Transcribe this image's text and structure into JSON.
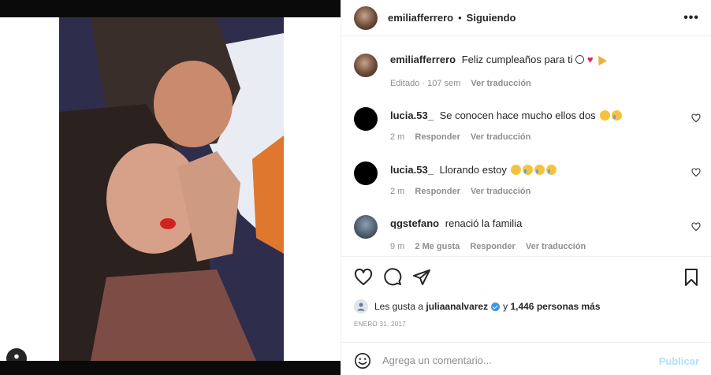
{
  "post": {
    "username": "emiliafferrero",
    "follow_status": "Siguiendo",
    "more_label": "•••"
  },
  "caption": {
    "username": "emiliafferrero",
    "text": "Feliz cumpleaños para ti",
    "emojis": [
      "soccer-ball",
      "red-heart",
      "party-popper"
    ],
    "edited": "Editado · 107 sem",
    "translate": "Ver traducción"
  },
  "comments": [
    {
      "username": "lucia.53_",
      "text": "Se conocen hace mucho ellos dos",
      "emojis": [
        "sad-face",
        "crying-face"
      ],
      "time": "2 m",
      "likes": "",
      "reply": "Responder",
      "translate": "Ver traducción"
    },
    {
      "username": "lucia.53_",
      "text": "Llorando estoy",
      "emojis": [
        "sad-face",
        "crying-face",
        "crying-face",
        "crying-face"
      ],
      "time": "2 m",
      "likes": "",
      "reply": "Responder",
      "translate": "Ver traducción"
    },
    {
      "username": "qgstefano",
      "text": "renació la familia",
      "emojis": [],
      "time": "9 m",
      "likes": "2 Me gusta",
      "reply": "Responder",
      "translate": "Ver traducción"
    }
  ],
  "likes": {
    "prefix": "Les gusta a",
    "user": "juliaanalvarez",
    "connector": "y",
    "count": "1,446 personas más"
  },
  "date": "ENERO 31, 2017",
  "composer": {
    "placeholder": "Agrega un comentario...",
    "publish": "Publicar"
  },
  "colors": {
    "text": "#262626",
    "muted": "#8e8e8e",
    "publish_disabled": "#b2dffc",
    "verified": "#3897f0"
  },
  "icons": [
    "like-icon",
    "comment-icon",
    "share-icon",
    "save-icon",
    "emoji-icon",
    "user-tag-icon",
    "heart-icon"
  ]
}
